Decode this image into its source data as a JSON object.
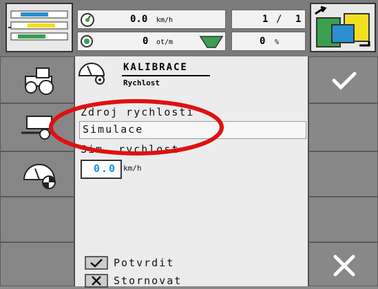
{
  "status": {
    "speed_value": "0.0",
    "speed_unit": "km/h",
    "counter_left": "1",
    "counter_sep": "/",
    "counter_right": "1",
    "rpm_value": "0",
    "rpm_unit": "ot/m",
    "pct_value": "0",
    "pct_unit": "%"
  },
  "header": {
    "title": "KALIBRACE",
    "subtitle": "Rychlost"
  },
  "form": {
    "source_label": "Zdroj rychlosti",
    "source_value": "Simulace",
    "sim_label": "Sim. rychlost",
    "sim_value": "0.0",
    "sim_unit": "km/h"
  },
  "footer": {
    "confirm_label": "Potvrdit",
    "cancel_label": "Stornovat"
  },
  "colors": {
    "accent": "#1a8fd8",
    "annotation": "#e01010"
  }
}
